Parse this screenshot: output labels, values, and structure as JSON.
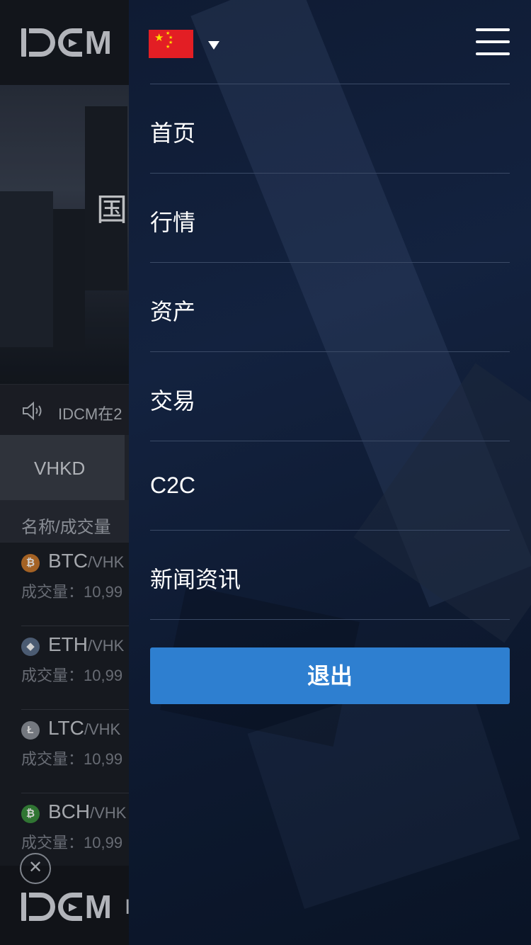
{
  "background": {
    "logo_text": "IDCM",
    "hero_text": "国",
    "notice_text": "IDCM在2",
    "tab_active": "VHKD",
    "list_header": "名称/成交量",
    "coins": [
      {
        "symbol": "BTC",
        "pair": "/VHK",
        "volume": "成交量：10,99",
        "color": "#c8782c",
        "glyph": "₿"
      },
      {
        "symbol": "ETH",
        "pair": "/VHK",
        "volume": "成交量：10,99",
        "color": "#5c6f8c",
        "glyph": "◆"
      },
      {
        "symbol": "LTC",
        "pair": "/VHK",
        "volume": "成交量：10,99",
        "color": "#8e939c",
        "glyph": "Ł"
      },
      {
        "symbol": "BCH",
        "pair": "/VHK",
        "volume": "成交量：10,99",
        "color": "#3b8f3f",
        "glyph": "₿"
      }
    ],
    "ad_close": "✕",
    "ad_text": "I"
  },
  "drawer": {
    "language": "zh-CN",
    "menu_items": [
      "首页",
      "行情",
      "资产",
      "交易",
      "C2C",
      "新闻资讯"
    ],
    "logout_label": "退出"
  },
  "colors": {
    "drawer_bg": "#13223f",
    "logout_bg": "#2e7fd0",
    "divider": "#3b4a66",
    "flag_red": "#e31e24",
    "flag_star": "#ffde00"
  }
}
